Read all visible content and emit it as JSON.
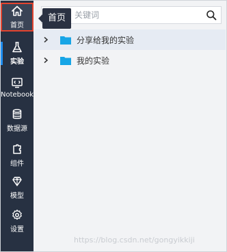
{
  "tooltip": {
    "text": "首页"
  },
  "sidebar": {
    "items": [
      {
        "label": "首页",
        "icon": "home-icon"
      },
      {
        "label": "实验",
        "icon": "flask-icon"
      },
      {
        "label": "Notebook",
        "icon": "notebook-icon"
      },
      {
        "label": "数据源",
        "icon": "database-icon"
      },
      {
        "label": "组件",
        "icon": "component-icon"
      },
      {
        "label": "模型",
        "icon": "model-icon"
      },
      {
        "label": "设置",
        "icon": "gear-icon"
      }
    ]
  },
  "search": {
    "placeholder": "关键词",
    "icon": "search-icon"
  },
  "tree": [
    {
      "label": "分享给我的实验",
      "icon": "folder-icon"
    },
    {
      "label": "我的实验",
      "icon": "folder-icon"
    }
  ],
  "watermark": "https://blog.csdn.net/gongyikkiji",
  "colors": {
    "sidebar": "#273142",
    "accent": "#1f8ff2",
    "folder": "#17a5e6",
    "highlight": "#e4442f"
  }
}
